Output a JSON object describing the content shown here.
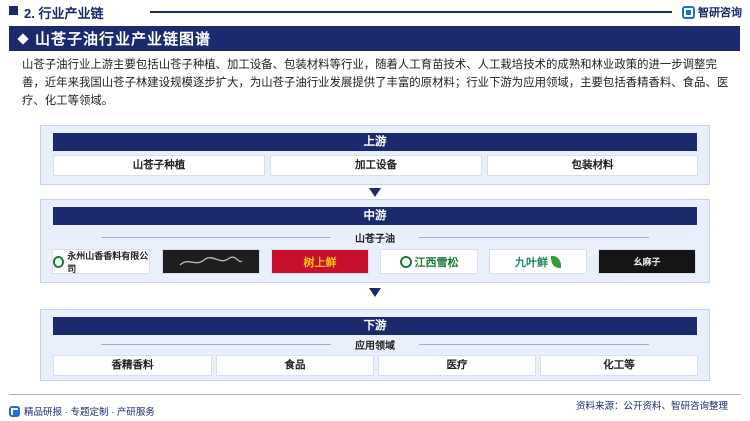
{
  "header": {
    "section": "2. 行业产业链",
    "brand": "智研咨询"
  },
  "title": "山苍子油行业产业链图谱",
  "intro": "山苍子油行业上游主要包括山苍子种植、加工设备、包装材料等行业，随着人工育苗技术、人工栽培技术的成熟和林业政策的进一步调整完善，近年来我国山苍子林建设规模逐步扩大，为山苍子油行业发展提供了丰富的原材料；行业下游为应用领域，主要包括香精香料、食品、医疗、化工等领域。",
  "upstream": {
    "label": "上游",
    "items": [
      "山苍子种植",
      "加工设备",
      "包装材料"
    ]
  },
  "midstream": {
    "label": "中游",
    "sublabel": "山苍子油",
    "logos": [
      "永州山香香料有限公司",
      "",
      "树上鲜",
      "江西雪松",
      "九叶鲜",
      "幺麻子"
    ]
  },
  "downstream": {
    "label": "下游",
    "sublabel": "应用领域",
    "items": [
      "香精香料",
      "食品",
      "医疗",
      "化工等"
    ]
  },
  "footer": {
    "left": "精品研报 · 专题定制 · 产研服务",
    "source": "资料来源：公开资料、智研咨询整理"
  },
  "colors": {
    "navy": "#1a2a6c",
    "panel": "#eaf0fb",
    "accent": "#1f6fd6"
  }
}
